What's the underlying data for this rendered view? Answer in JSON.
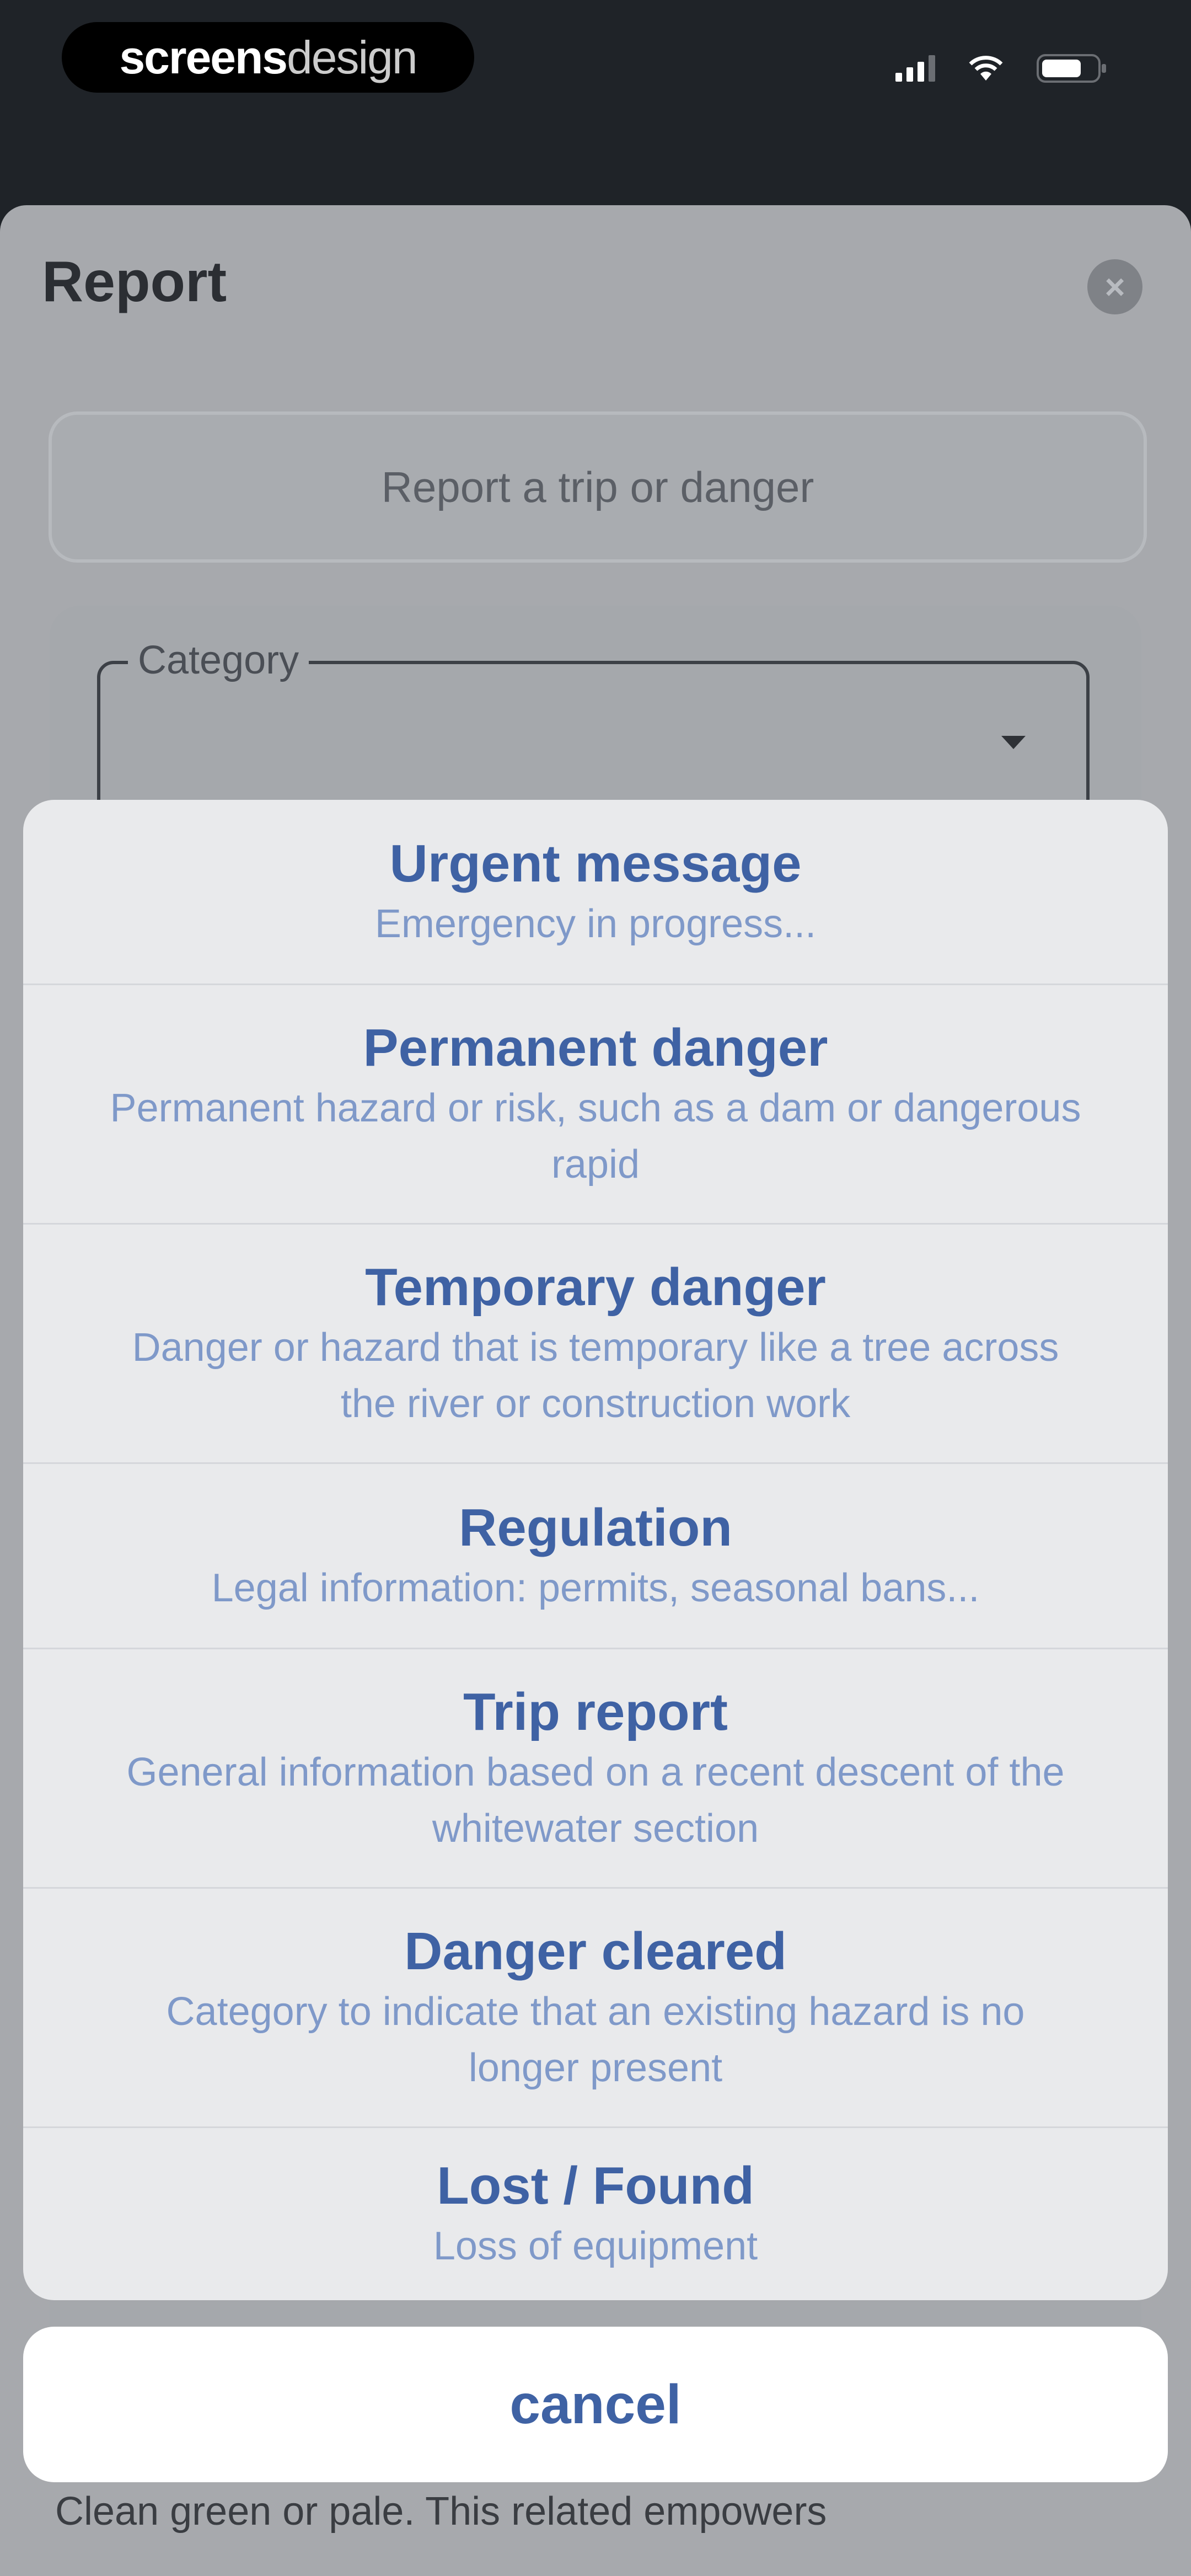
{
  "status_bar": {
    "brand_part1": "screens",
    "brand_part2": "design"
  },
  "sheet": {
    "title": "Report",
    "close_icon": "close-icon",
    "report_type_button": "Report a trip or danger",
    "category_label": "Category",
    "partial_text": "Clean green or pale. This related empowers"
  },
  "action_sheet": {
    "options": [
      {
        "title": "Urgent message",
        "description": "Emergency in progress..."
      },
      {
        "title": "Permanent danger",
        "description": "Permanent hazard or risk, such as a dam or dangerous rapid"
      },
      {
        "title": "Temporary danger",
        "description": "Danger or hazard that is temporary like a tree across the river or construction work"
      },
      {
        "title": "Regulation",
        "description": "Legal information: permits, seasonal bans..."
      },
      {
        "title": "Trip report",
        "description": "General information based on a recent descent of the whitewater section"
      },
      {
        "title": "Danger cleared",
        "description": "Category to indicate that an existing hazard is no longer present"
      },
      {
        "title": "Lost / Found",
        "description": "Loss of equipment"
      }
    ],
    "cancel_label": "cancel"
  },
  "colors": {
    "accent": "#3f62a4",
    "accent_light": "#7f99c9",
    "sheet_background": "#e9eaec",
    "status_background": "#1f2328"
  }
}
